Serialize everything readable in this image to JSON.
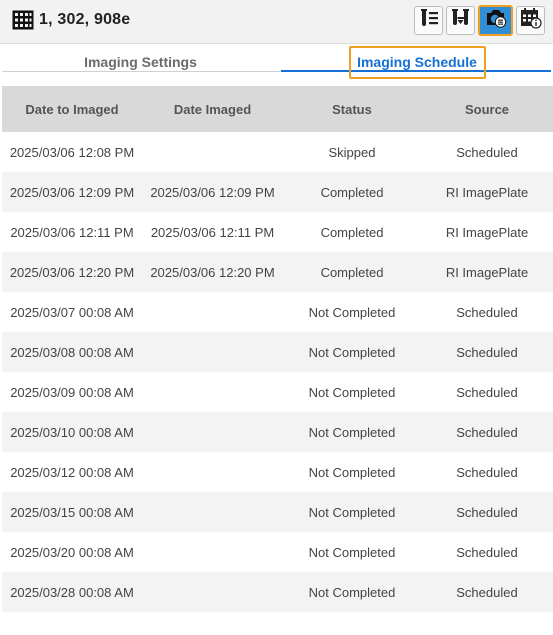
{
  "header": {
    "plate_title": "1, 302, 908e",
    "icons": [
      "plate-grid-icon",
      "list-tube-icon",
      "tubes-icon",
      "camera-list-icon",
      "calendar-info-icon"
    ],
    "accent_color": "#1570d6",
    "active_color": "#2f8ed6",
    "focus_color": "#f0a020"
  },
  "tabs": [
    {
      "label": "Imaging Settings",
      "active": false
    },
    {
      "label": "Imaging Schedule",
      "active": true
    }
  ],
  "table": {
    "columns": [
      "Date to Imaged",
      "Date Imaged",
      "Status",
      "Source"
    ],
    "rows": [
      {
        "date_to_imaged": "2025/03/06 12:08 PM",
        "date_imaged": "",
        "status": "Skipped",
        "source": "Scheduled"
      },
      {
        "date_to_imaged": "2025/03/06 12:09 PM",
        "date_imaged": "2025/03/06 12:09 PM",
        "status": "Completed",
        "source": "RI ImagePlate"
      },
      {
        "date_to_imaged": "2025/03/06 12:11 PM",
        "date_imaged": "2025/03/06 12:11 PM",
        "status": "Completed",
        "source": "RI ImagePlate"
      },
      {
        "date_to_imaged": "2025/03/06 12:20 PM",
        "date_imaged": "2025/03/06 12:20 PM",
        "status": "Completed",
        "source": "RI ImagePlate"
      },
      {
        "date_to_imaged": "2025/03/07 00:08 AM",
        "date_imaged": "",
        "status": "Not Completed",
        "source": "Scheduled"
      },
      {
        "date_to_imaged": "2025/03/08 00:08 AM",
        "date_imaged": "",
        "status": "Not Completed",
        "source": "Scheduled"
      },
      {
        "date_to_imaged": "2025/03/09 00:08 AM",
        "date_imaged": "",
        "status": "Not Completed",
        "source": "Scheduled"
      },
      {
        "date_to_imaged": "2025/03/10 00:08 AM",
        "date_imaged": "",
        "status": "Not Completed",
        "source": "Scheduled"
      },
      {
        "date_to_imaged": "2025/03/12 00:08 AM",
        "date_imaged": "",
        "status": "Not Completed",
        "source": "Scheduled"
      },
      {
        "date_to_imaged": "2025/03/15 00:08 AM",
        "date_imaged": "",
        "status": "Not Completed",
        "source": "Scheduled"
      },
      {
        "date_to_imaged": "2025/03/20 00:08 AM",
        "date_imaged": "",
        "status": "Not Completed",
        "source": "Scheduled"
      },
      {
        "date_to_imaged": "2025/03/28 00:08 AM",
        "date_imaged": "",
        "status": "Not Completed",
        "source": "Scheduled"
      }
    ]
  }
}
